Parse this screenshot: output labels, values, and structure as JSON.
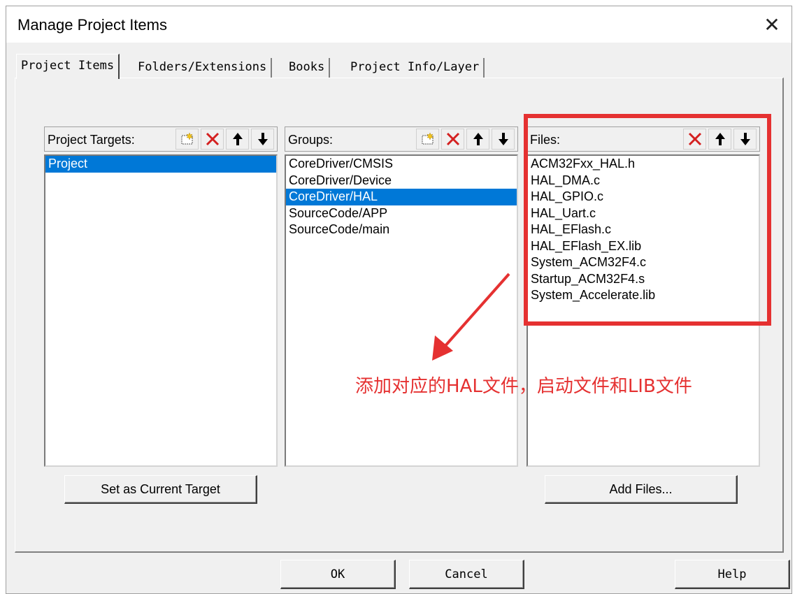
{
  "window": {
    "title": "Manage Project Items",
    "close_glyph": "✕"
  },
  "tabs": [
    {
      "label": "Project Items",
      "active": true
    },
    {
      "label": "Folders/Extensions",
      "active": false
    },
    {
      "label": "Books",
      "active": false
    },
    {
      "label": "Project Info/Layer",
      "active": false
    }
  ],
  "targets": {
    "label": "Project Targets:",
    "icons": [
      "new-icon",
      "delete-icon",
      "move-up-icon",
      "move-down-icon"
    ],
    "items": [
      "Project"
    ],
    "selected_index": 0
  },
  "groups": {
    "label": "Groups:",
    "icons": [
      "new-icon",
      "delete-icon",
      "move-up-icon",
      "move-down-icon"
    ],
    "items": [
      "CoreDriver/CMSIS",
      "CoreDriver/Device",
      "CoreDriver/HAL",
      "SourceCode/APP",
      "SourceCode/main"
    ],
    "selected_index": 2
  },
  "files": {
    "label": "Files:",
    "icons": [
      "delete-icon",
      "move-up-icon",
      "move-down-icon"
    ],
    "items": [
      "ACM32Fxx_HAL.h",
      "HAL_DMA.c",
      "HAL_GPIO.c",
      "HAL_Uart.c",
      "HAL_EFlash.c",
      "HAL_EFlash_EX.lib",
      "System_ACM32F4.c",
      "Startup_ACM32F4.s",
      "System_Accelerate.lib"
    ]
  },
  "buttons": {
    "set_current_target": "Set as Current Target",
    "add_files": "Add Files...",
    "ok": "OK",
    "cancel": "Cancel",
    "help": "Help"
  },
  "annotation": {
    "text": "添加对应的HAL文件，启动文件和LIB文件",
    "color": "#e53131"
  },
  "colors": {
    "selection": "#0078d7",
    "dialog_bg": "#f0f0f0",
    "delete_icon": "#d42020"
  }
}
